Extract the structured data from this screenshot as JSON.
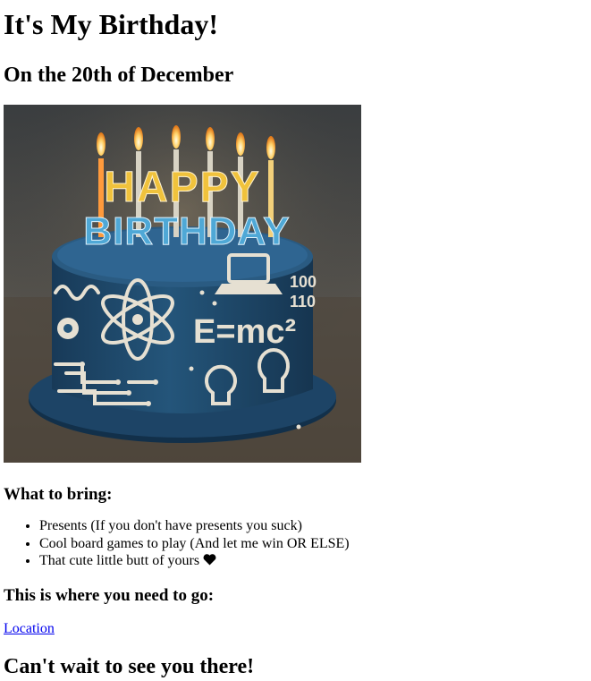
{
  "header": {
    "title": "It's My Birthday!",
    "date_line": "On the 20th of December"
  },
  "image": {
    "cake_text_top": "HAPPY",
    "cake_text_bottom": "BIRTHDAY",
    "equation": "E=mc²",
    "binary_top": "100",
    "binary_bottom": "110",
    "colors": {
      "cake": "#1f4a6e",
      "background_top": "#3c3f41",
      "background_bottom": "#5a5348",
      "frosting": "#e6e0d2"
    }
  },
  "bring": {
    "heading": "What to bring:",
    "items": [
      "Presents (If you don't have presents you suck)",
      "Cool board games to play (And let me win OR ELSE)",
      "That cute little butt of yours"
    ],
    "heart_icon": "heart-icon"
  },
  "location": {
    "heading": "This is where you need to go:",
    "link_label": "Location"
  },
  "closing": {
    "text": "Can't wait to see you there!"
  }
}
